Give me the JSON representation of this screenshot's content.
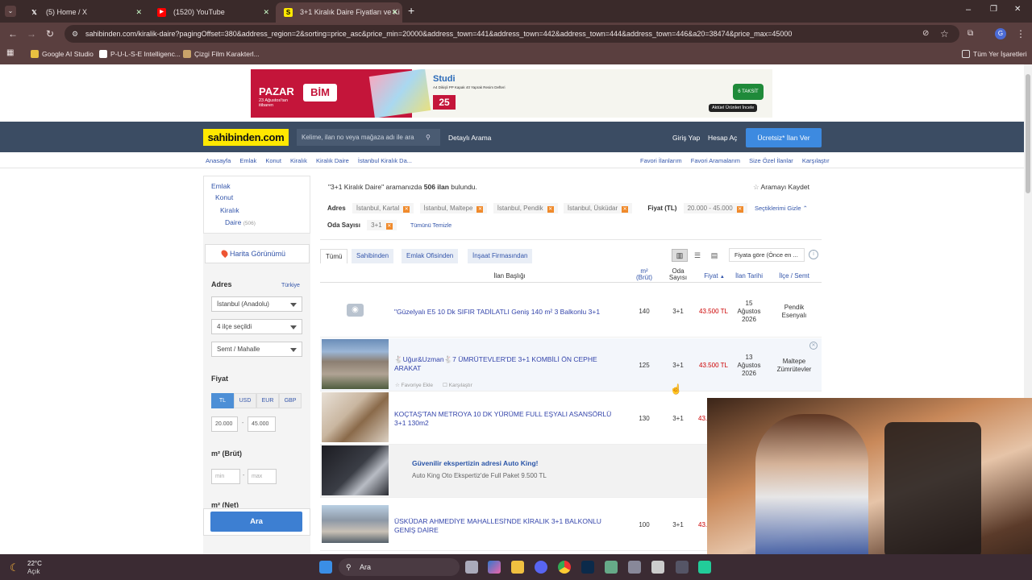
{
  "browser": {
    "tabs": [
      {
        "label": "(5) Home / X",
        "icon": "x-logo-icon"
      },
      {
        "label": "(1520) YouTube",
        "icon": "youtube-icon"
      },
      {
        "label": "3+1 Kiralık Daire Fiyatları ve Ki",
        "icon": "sahibinden-icon"
      }
    ],
    "new_tab": "+",
    "url": "sahibinden.com/kiralik-daire?pagingOffset=380&address_region=2&sorting=price_asc&price_min=20000&address_town=441&address_town=442&address_town=444&address_town=446&a20=38474&price_max=45000",
    "bookmarks": [
      "Google AI Studio",
      "P-U-L-S-E Intelligenc...",
      "Çizgi Film Karakterl..."
    ],
    "all_bookmarks": "Tüm Yer İşaretleri",
    "profile": "G"
  },
  "banner": {
    "left_text": "PAZAR",
    "date_text": "23 Ağustos'tan itibaren",
    "brand": "BİM",
    "product": "Studi",
    "product_desc": "A4 Dikişli PP Kapak 40 Yaprak Resim Defteri",
    "price": "25",
    "installments": "6 TAKSİT",
    "cta": "Aktüel Ürünleri İncele"
  },
  "header": {
    "logo": "sahibinden.com",
    "search_placeholder": "Kelime, ilan no veya mağaza adı ile ara",
    "detailed_search": "Detaylı Arama",
    "login": "Giriş Yap",
    "register": "Hesap Aç",
    "post_ad": "Ücretsiz* İlan Ver"
  },
  "breadcrumb": [
    "Anasayfa",
    "Emlak",
    "Konut",
    "Kiralık",
    "Kiralık Daire",
    "İstanbul Kiralık Da..."
  ],
  "top_links": [
    "Favori İlanlarım",
    "Favori Aramalarım",
    "Size Özel İlanlar",
    "Karşılaştır"
  ],
  "sidebar": {
    "categories": [
      {
        "label": "Emlak"
      },
      {
        "label": "Konut"
      },
      {
        "label": "Kiralık"
      },
      {
        "label": "Daire",
        "count": "(506)"
      }
    ],
    "map_view": "Harita Görünümü",
    "address_label": "Adres",
    "country": "Türkiye",
    "city": "İstanbul (Anadolu)",
    "districts": "4 ilçe seçildi",
    "neighborhood": "Semt / Mahalle",
    "price_label": "Fiyat",
    "currencies": [
      "TL",
      "USD",
      "EUR",
      "GBP"
    ],
    "active_currency": "TL",
    "price_min": "20.000",
    "price_max": "45.000",
    "m2_label": "m² (Brüt)",
    "m2_min_placeholder": "min",
    "m2_max_placeholder": "max",
    "m2_net_label": "m² (Net)",
    "search_button": "Ara"
  },
  "results": {
    "query": "\"3+1 Kiralık Daire\"",
    "found_mid": " aramanızda ",
    "count": "506 ilan",
    "found_suffix": " bulundu.",
    "save_search": "Aramayı Kaydet",
    "filters_address_label": "Adres",
    "address_chips": [
      "İstanbul, Kartal",
      "İstanbul, Maltepe",
      "İstanbul, Pendik",
      "İstanbul, Üsküdar"
    ],
    "price_label": "Fiyat (TL)",
    "price_chip": "20.000 - 45.000",
    "hide_selected": "Seçtiklerimi Gizle",
    "rooms_label": "Oda Sayısı",
    "rooms_chip": "3+1",
    "clear_all": "Tümünü Temizle",
    "filter_tabs": [
      "Tümü",
      "Sahibinden",
      "Emlak Ofisinden",
      "İnşaat Firmasından"
    ],
    "sort_label": "Fiyata göre (Önce en ...",
    "columns": {
      "title": "İlan Başlığı",
      "m2": "m²",
      "m2_sub": "(Brüt)",
      "rooms": "Oda",
      "rooms_sub": "Sayısı",
      "price": "Fiyat",
      "date": "İlan Tarihi",
      "location": "İlçe / Semt"
    },
    "listings": [
      {
        "title": "\"Güzelyalı E5 10 Dk SIFIR TADİLATLI Geniş 140 m² 3 Balkonlu 3+1",
        "m2": "140",
        "rooms": "3+1",
        "price": "43.500 TL",
        "date_day": "15",
        "date_month": "Ağustos",
        "date_year": "2026",
        "district": "Pendik",
        "area": "Esenyalı"
      },
      {
        "title": "🐇Uğur&Uzman🐇7 ÜMRÜTEVLER'DE 3+1 KOMBİLİ ÖN CEPHE ARAKAT",
        "m2": "125",
        "rooms": "3+1",
        "price": "43.500 TL",
        "date_day": "13",
        "date_month": "Ağustos",
        "date_year": "2026",
        "district": "Maltepe",
        "area": "Zümrütevler",
        "fav": "Favoriye Ekle",
        "compare": "Karşılaştır"
      },
      {
        "title": "KOÇTAŞ'TAN METROYA 10 DK YÜRÜME FULL EŞYALI ASANSÖRLÜ 3+1 130m2",
        "m2": "130",
        "rooms": "3+1",
        "price": "43."
      },
      {
        "ad_title": "Güvenilir ekspertizin adresi Auto King!",
        "ad_desc": "Auto King Oto Ekspertiz'de Full Paket 9.500 TL"
      },
      {
        "title": "ÜSKÜDAR AHMEDİYE MAHALLESİ'NDE KİRALIK 3+1 BALKONLU GENİŞ DAİRE",
        "m2": "100",
        "rooms": "3+1",
        "price": "43."
      }
    ]
  },
  "taskbar": {
    "temp": "22°C",
    "weather": "Açık",
    "search": "Ara"
  }
}
